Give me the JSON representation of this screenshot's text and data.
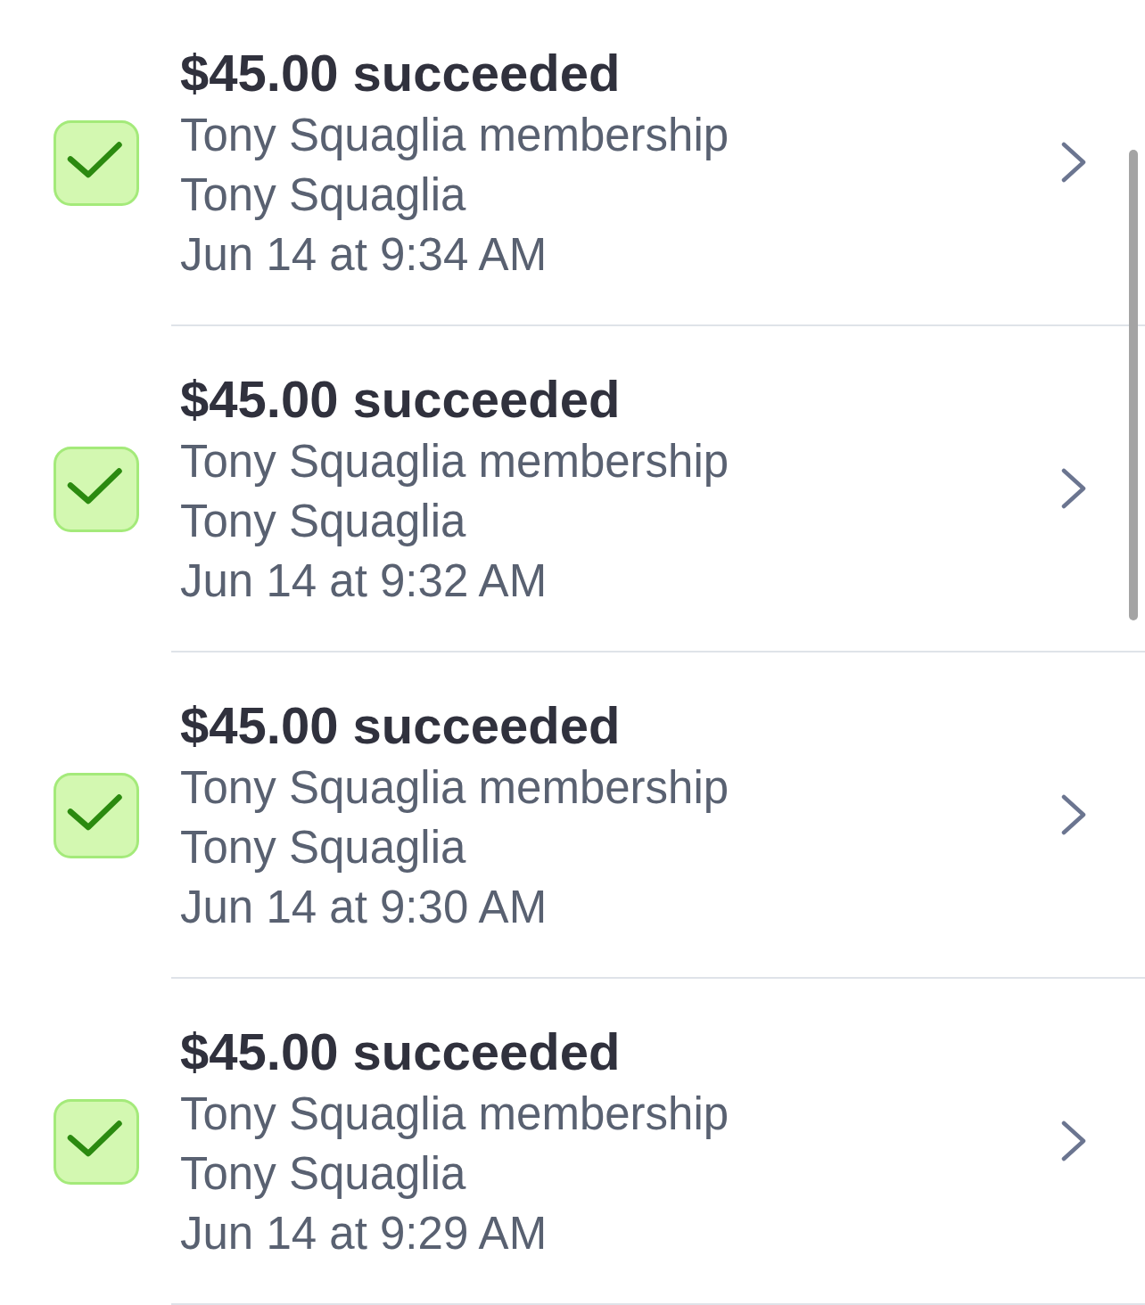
{
  "rows": [
    {
      "checked": true,
      "title": "$45.00 succeeded",
      "description": "Tony Squaglia membership",
      "customer": "Tony Squaglia",
      "date": "Jun 14 at 9:34 AM"
    },
    {
      "checked": true,
      "title": "$45.00 succeeded",
      "description": "Tony Squaglia membership",
      "customer": "Tony Squaglia",
      "date": "Jun 14 at 9:32 AM"
    },
    {
      "checked": true,
      "title": "$45.00 succeeded",
      "description": "Tony Squaglia membership",
      "customer": "Tony Squaglia",
      "date": "Jun 14 at 9:30 AM"
    },
    {
      "checked": true,
      "title": "$45.00 succeeded",
      "description": "Tony Squaglia membership",
      "customer": "Tony Squaglia",
      "date": "Jun 14 at 9:29 AM"
    }
  ]
}
